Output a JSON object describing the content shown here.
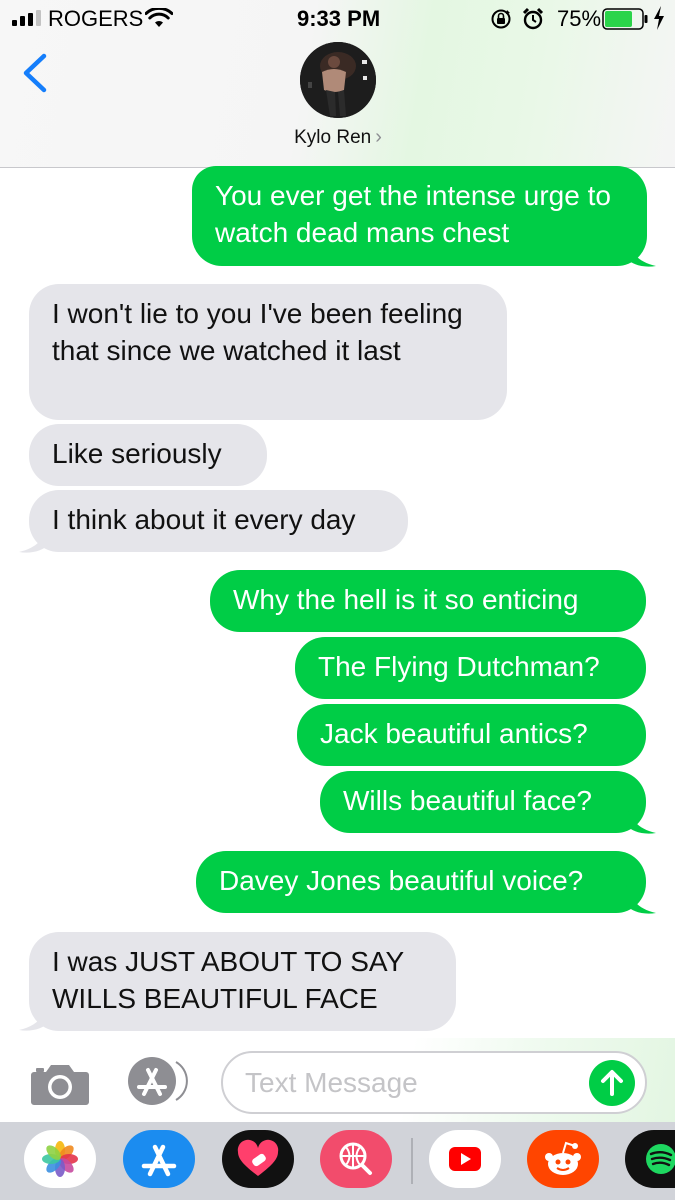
{
  "status_bar": {
    "carrier": "ROGERS",
    "time": "9:33 PM",
    "battery_percent": "75%",
    "battery_level": 0.75,
    "icons": [
      "signal-icon",
      "wifi-icon",
      "rotation-lock-icon",
      "alarm-icon",
      "battery-icon",
      "charging-bolt-icon"
    ]
  },
  "header": {
    "contact_name": "Kylo Ren",
    "chevron": "›",
    "back_icon": "chevron-left-icon"
  },
  "messages": [
    {
      "from": "me",
      "text": "You ever get the intense urge to watch dead mans chest",
      "tail": true
    },
    {
      "from": "them",
      "text": "I won't lie to you I've been feeling that since we watched it last",
      "tail": false
    },
    {
      "from": "them",
      "text": "Like seriously",
      "tail": false
    },
    {
      "from": "them",
      "text": "I think about it every day",
      "tail": true
    },
    {
      "from": "me",
      "text": "Why the hell is it so enticing",
      "tail": false
    },
    {
      "from": "me",
      "text": "The Flying Dutchman?",
      "tail": false
    },
    {
      "from": "me",
      "text": "Jack beautiful antics?",
      "tail": false
    },
    {
      "from": "me",
      "text": "Wills beautiful face?",
      "tail": true
    },
    {
      "from": "me",
      "text": "Davey Jones beautiful voice?",
      "tail": true
    },
    {
      "from": "them",
      "text": "I was JUST ABOUT TO SAY WILLS BEAUTIFUL FACE",
      "tail": true
    }
  ],
  "input": {
    "placeholder": "Text Message",
    "value": ""
  },
  "colors": {
    "sent_bubble": "#00cd46",
    "received_bubble": "#e5e5ea",
    "ios_blue": "#157efb"
  },
  "app_drawer": [
    "photos-app-icon",
    "app-store-icon",
    "heart-app-icon",
    "search-globe-app-icon",
    "youtube-app-icon",
    "reddit-app-icon",
    "spotify-app-icon"
  ]
}
